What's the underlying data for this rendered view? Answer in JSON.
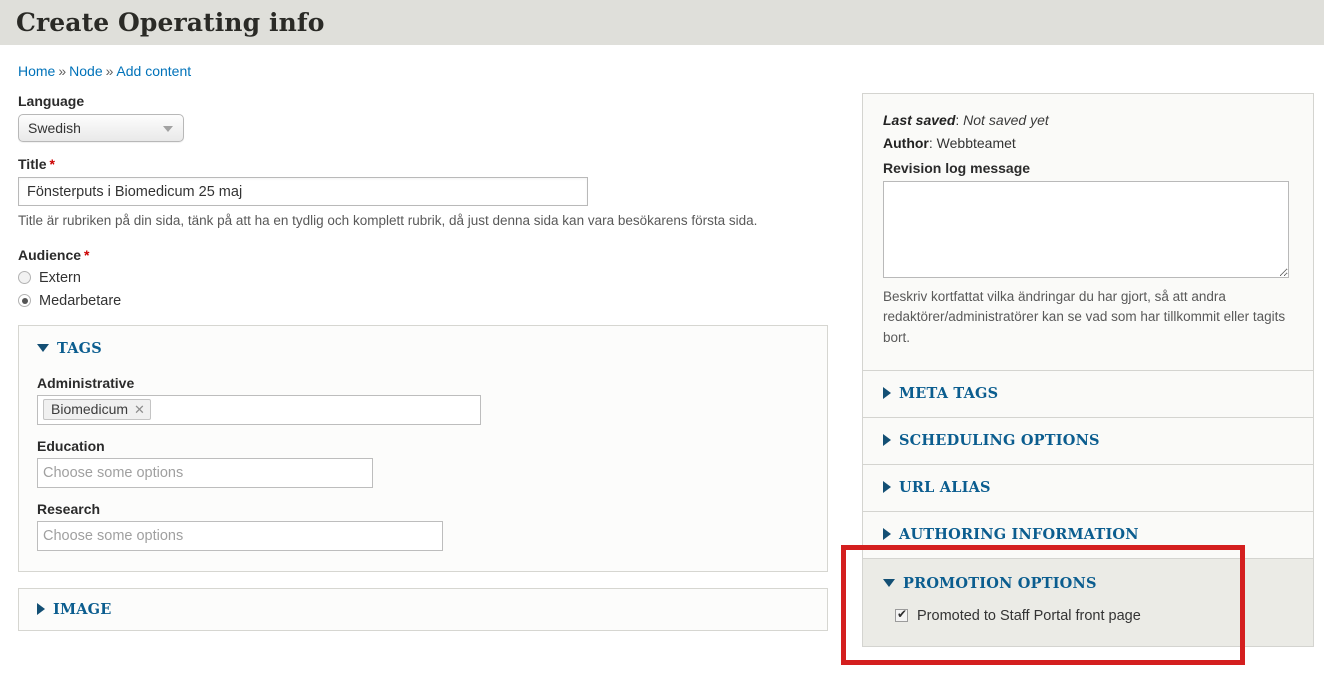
{
  "header": {
    "title": "Create Operating info"
  },
  "breadcrumb": {
    "items": [
      {
        "label": "Home"
      },
      {
        "label": "Node"
      },
      {
        "label": "Add content"
      }
    ],
    "separator": "»"
  },
  "form": {
    "language": {
      "label": "Language",
      "value": "Swedish",
      "options": [
        "Swedish"
      ]
    },
    "title": {
      "label": "Title",
      "required_marker": "*",
      "value": "Fönsterputs i Biomedicum 25 maj",
      "description": "Title är rubriken på din sida, tänk på att ha en tydlig och komplett rubrik, då just denna sida kan vara besökarens första sida."
    },
    "audience": {
      "label": "Audience",
      "required_marker": "*",
      "options": [
        {
          "label": "Extern",
          "selected": false
        },
        {
          "label": "Medarbetare",
          "selected": true
        }
      ]
    },
    "tags_fieldset": {
      "legend": "TAGS",
      "expanded": true,
      "administrative": {
        "label": "Administrative",
        "chips": [
          {
            "label": "Biomedicum",
            "remove_icon": "✕"
          }
        ]
      },
      "education": {
        "label": "Education",
        "placeholder": "Choose some options",
        "value": ""
      },
      "research": {
        "label": "Research",
        "placeholder": "Choose some options",
        "value": ""
      }
    },
    "image_fieldset": {
      "legend": "IMAGE",
      "expanded": false
    }
  },
  "sidebar": {
    "summary": {
      "last_saved_label": "Last saved",
      "last_saved_value": "Not saved yet",
      "author_label": "Author",
      "author_value": "Webbteamet",
      "revision_label": "Revision log message",
      "revision_value": "",
      "revision_description": "Beskriv kortfattat vilka ändringar du har gjort, så att andra redaktörer/administratörer kan se vad som har tillkommit eller tagits bort."
    },
    "sections": [
      {
        "title": "META TAGS",
        "expanded": false
      },
      {
        "title": "SCHEDULING OPTIONS",
        "expanded": false
      },
      {
        "title": "URL ALIAS",
        "expanded": false
      },
      {
        "title": "AUTHORING INFORMATION",
        "expanded": false
      }
    ],
    "promotion": {
      "title": "PROMOTION OPTIONS",
      "expanded": true,
      "checkbox_label": "Promoted to Staff Portal front page",
      "checked": true
    }
  },
  "annotation": {
    "color": "#d41f1f"
  }
}
